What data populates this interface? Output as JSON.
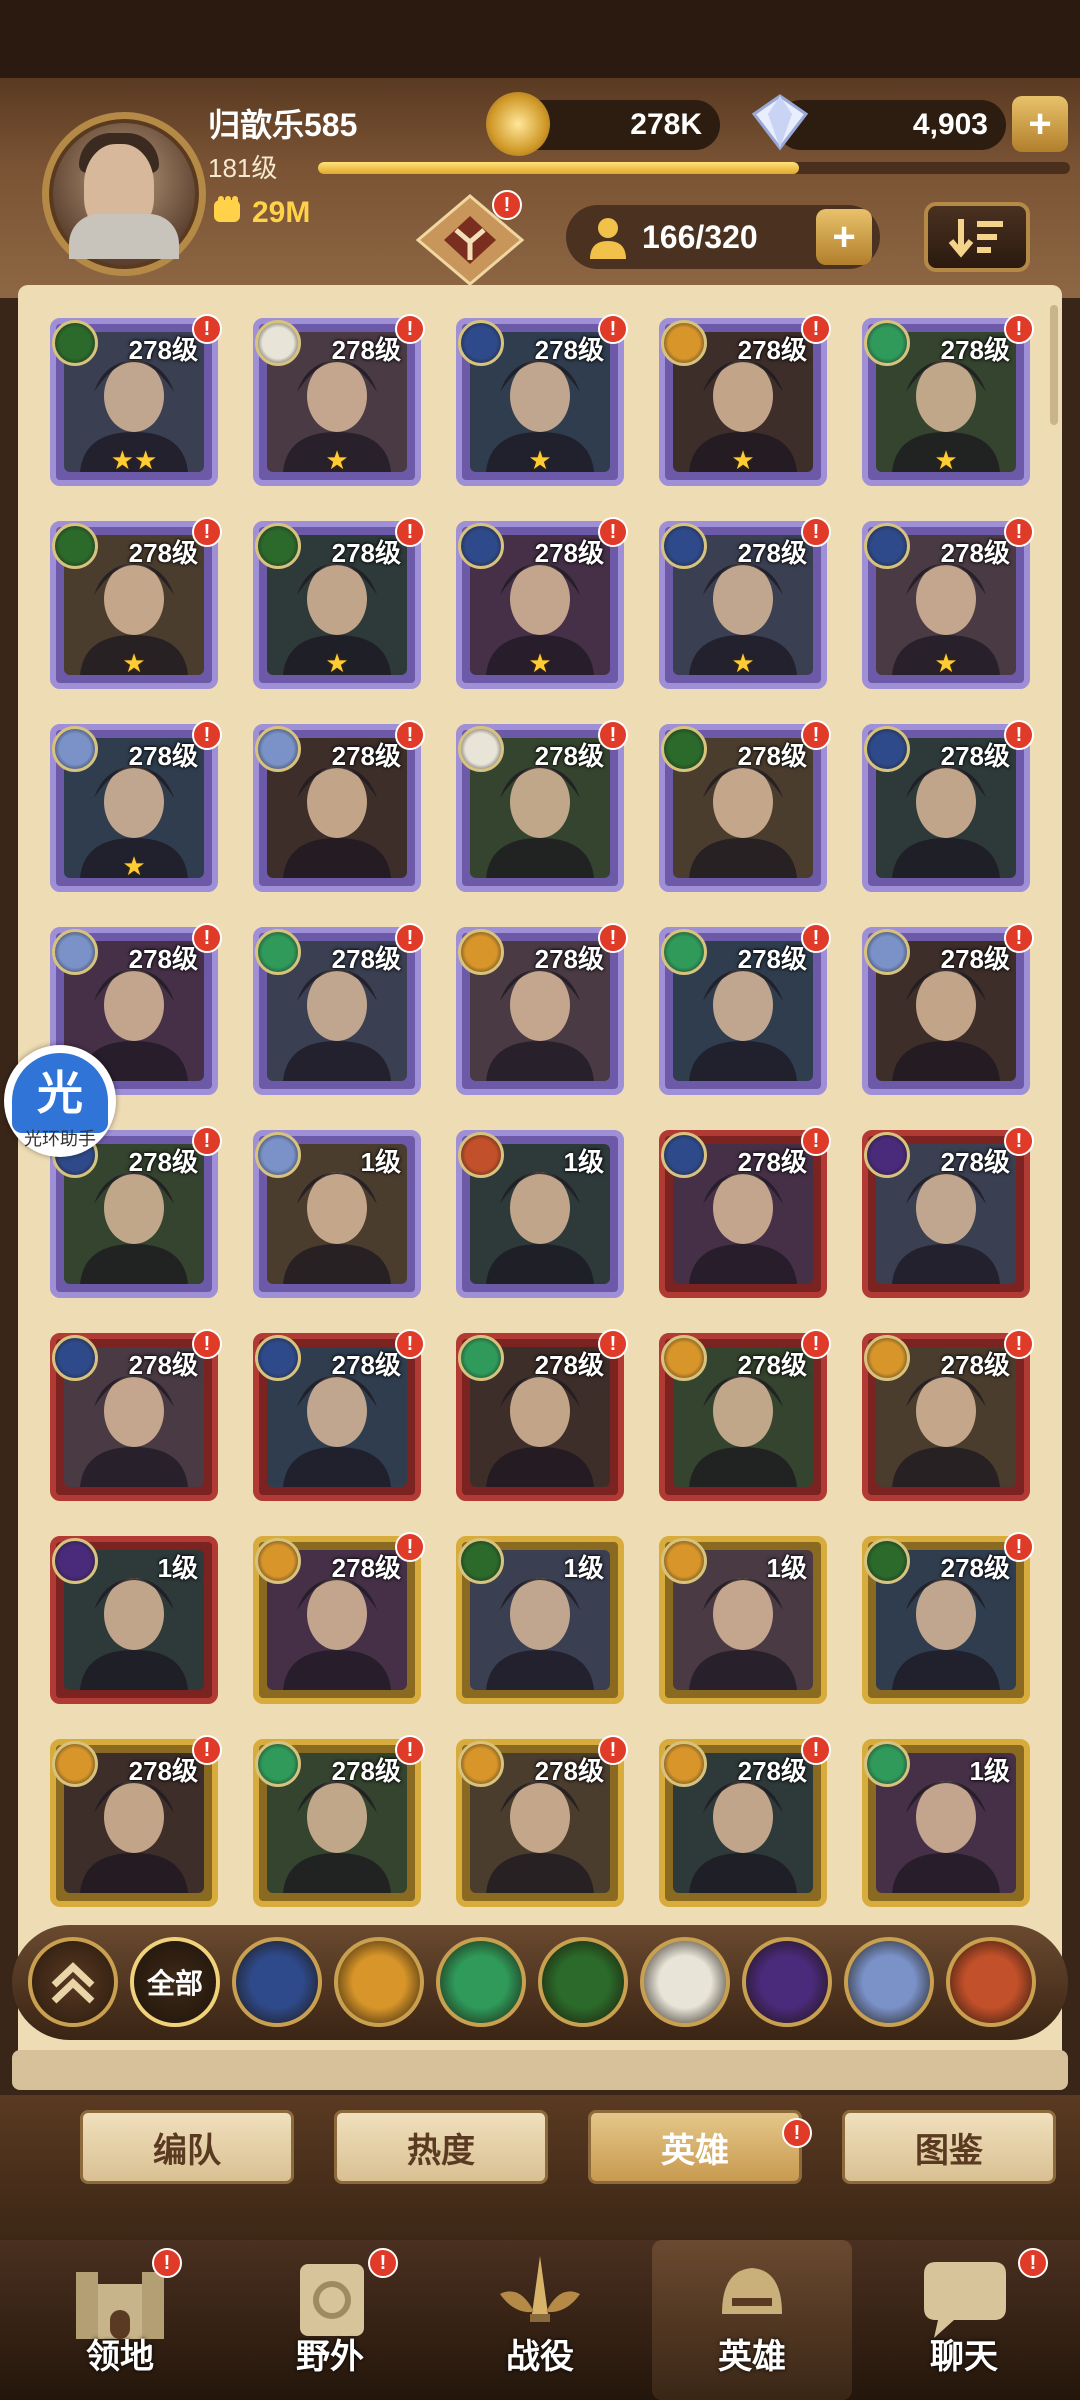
{
  "player": {
    "name": "归歆乐585",
    "level": "181级",
    "power": "29M",
    "xp_progress": 0.64
  },
  "resources": {
    "gold": "278K",
    "gems": "4,903",
    "plus_label": "+"
  },
  "hero_capacity": "166/320",
  "badge": "!",
  "heroes": [
    {
      "level": "278级",
      "frame": "purple",
      "faction": "forest",
      "stars": "★★"
    },
    {
      "level": "278级",
      "frame": "purple",
      "faction": "celestial",
      "stars": "★"
    },
    {
      "level": "278级",
      "frame": "purple",
      "faction": "lightbearer",
      "stars": "★"
    },
    {
      "level": "278级",
      "frame": "purple",
      "faction": "mauler",
      "stars": "★"
    },
    {
      "level": "278级",
      "frame": "purple",
      "faction": "wilder",
      "stars": "★"
    },
    {
      "level": "278级",
      "frame": "purple",
      "faction": "forest",
      "stars": "★"
    },
    {
      "level": "278级",
      "frame": "purple",
      "faction": "forest",
      "stars": "★"
    },
    {
      "level": "278级",
      "frame": "purple",
      "faction": "lightbearer",
      "stars": "★"
    },
    {
      "level": "278级",
      "frame": "purple",
      "faction": "lightbearer",
      "stars": "★"
    },
    {
      "level": "278级",
      "frame": "purple",
      "faction": "lightbearer",
      "stars": "★"
    },
    {
      "level": "278级",
      "frame": "purple",
      "faction": "dimensional",
      "stars": "★"
    },
    {
      "level": "278级",
      "frame": "purple",
      "faction": "dimensional",
      "stars": ""
    },
    {
      "level": "278级",
      "frame": "purple",
      "faction": "celestial",
      "stars": ""
    },
    {
      "level": "278级",
      "frame": "purple",
      "faction": "forest",
      "stars": ""
    },
    {
      "level": "278级",
      "frame": "purple",
      "faction": "lightbearer",
      "stars": ""
    },
    {
      "level": "278级",
      "frame": "purple",
      "faction": "dimensional",
      "stars": ""
    },
    {
      "level": "278级",
      "frame": "purple",
      "faction": "wilder",
      "stars": ""
    },
    {
      "level": "278级",
      "frame": "purple",
      "faction": "mauler",
      "stars": ""
    },
    {
      "level": "278级",
      "frame": "purple",
      "faction": "wilder",
      "stars": ""
    },
    {
      "level": "278级",
      "frame": "purple",
      "faction": "dimensional",
      "stars": ""
    },
    {
      "level": "278级",
      "frame": "purple",
      "faction": "lightbearer",
      "stars": ""
    },
    {
      "level": "1级",
      "frame": "purple",
      "faction": "dimensional",
      "stars": ""
    },
    {
      "level": "1级",
      "frame": "purple",
      "faction": "fire",
      "stars": ""
    },
    {
      "level": "278级",
      "frame": "red",
      "faction": "lightbearer",
      "stars": ""
    },
    {
      "level": "278级",
      "frame": "red",
      "faction": "graveborn",
      "stars": ""
    },
    {
      "level": "278级",
      "frame": "red",
      "faction": "lightbearer",
      "stars": ""
    },
    {
      "level": "278级",
      "frame": "red",
      "faction": "lightbearer",
      "stars": ""
    },
    {
      "level": "278级",
      "frame": "red",
      "faction": "wilder",
      "stars": ""
    },
    {
      "level": "278级",
      "frame": "red",
      "faction": "mauler",
      "stars": ""
    },
    {
      "level": "278级",
      "frame": "red",
      "faction": "mauler",
      "stars": ""
    },
    {
      "level": "1级",
      "frame": "red",
      "faction": "graveborn",
      "stars": ""
    },
    {
      "level": "278级",
      "frame": "gold",
      "faction": "mauler",
      "stars": ""
    },
    {
      "level": "1级",
      "frame": "gold",
      "faction": "forest",
      "stars": ""
    },
    {
      "level": "1级",
      "frame": "gold",
      "faction": "mauler",
      "stars": ""
    },
    {
      "level": "278级",
      "frame": "gold",
      "faction": "forest",
      "stars": ""
    },
    {
      "level": "278级",
      "frame": "gold",
      "faction": "mauler",
      "stars": ""
    },
    {
      "level": "278级",
      "frame": "gold",
      "faction": "wilder",
      "stars": ""
    },
    {
      "level": "278级",
      "frame": "gold",
      "faction": "mauler",
      "stars": ""
    },
    {
      "level": "278级",
      "frame": "gold",
      "faction": "mauler",
      "stars": ""
    },
    {
      "level": "1级",
      "frame": "gold",
      "faction": "wilder",
      "stars": ""
    }
  ],
  "filters": {
    "all_label": "全部",
    "factions": [
      "lightbearer",
      "mauler",
      "wilder",
      "forest",
      "celestial",
      "graveborn",
      "dimensional",
      "fire"
    ]
  },
  "tabs": [
    "编队",
    "热度",
    "英雄",
    "图鉴"
  ],
  "nav": [
    "领地",
    "野外",
    "战役",
    "英雄",
    "聊天"
  ],
  "helper": {
    "icon": "光",
    "label": "光环助手"
  },
  "colors": {
    "lightbearer": "#2f4a8a",
    "mauler": "#d8962a",
    "wilder": "#2f9a5a",
    "forest": "#2b6a2a",
    "celestial": "#e8e4d8",
    "graveborn": "#4a2a7a",
    "dimensional": "#7a92c8",
    "fire": "#c2502a"
  }
}
